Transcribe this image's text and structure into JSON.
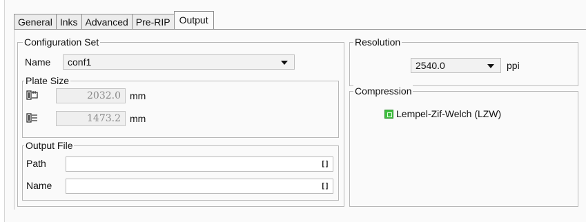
{
  "tabs": [
    {
      "label": "General"
    },
    {
      "label": "Inks"
    },
    {
      "label": "Advanced"
    },
    {
      "label": "Pre-RIP"
    },
    {
      "label": "Output"
    }
  ],
  "active_tab": "Output",
  "configuration_set": {
    "legend": "Configuration Set",
    "name_label": "Name",
    "name_value": "conf1",
    "plate_size": {
      "legend": "Plate Size",
      "width_value": "2032.0",
      "width_unit": "mm",
      "width_icon": "plate-width-icon",
      "height_value": "1473.2",
      "height_unit": "mm",
      "height_icon": "plate-height-icon"
    },
    "output_file": {
      "legend": "Output File",
      "path_label": "Path",
      "path_value": "",
      "name_label": "Name",
      "name_value": "",
      "browse_glyph": "[]"
    }
  },
  "resolution": {
    "legend": "Resolution",
    "value": "2540.0",
    "unit": "ppi"
  },
  "compression": {
    "legend": "Compression",
    "option_label": "Lempel-Zif-Welch (LZW)",
    "option_checked": true,
    "check_color": "#3fbf3f"
  }
}
